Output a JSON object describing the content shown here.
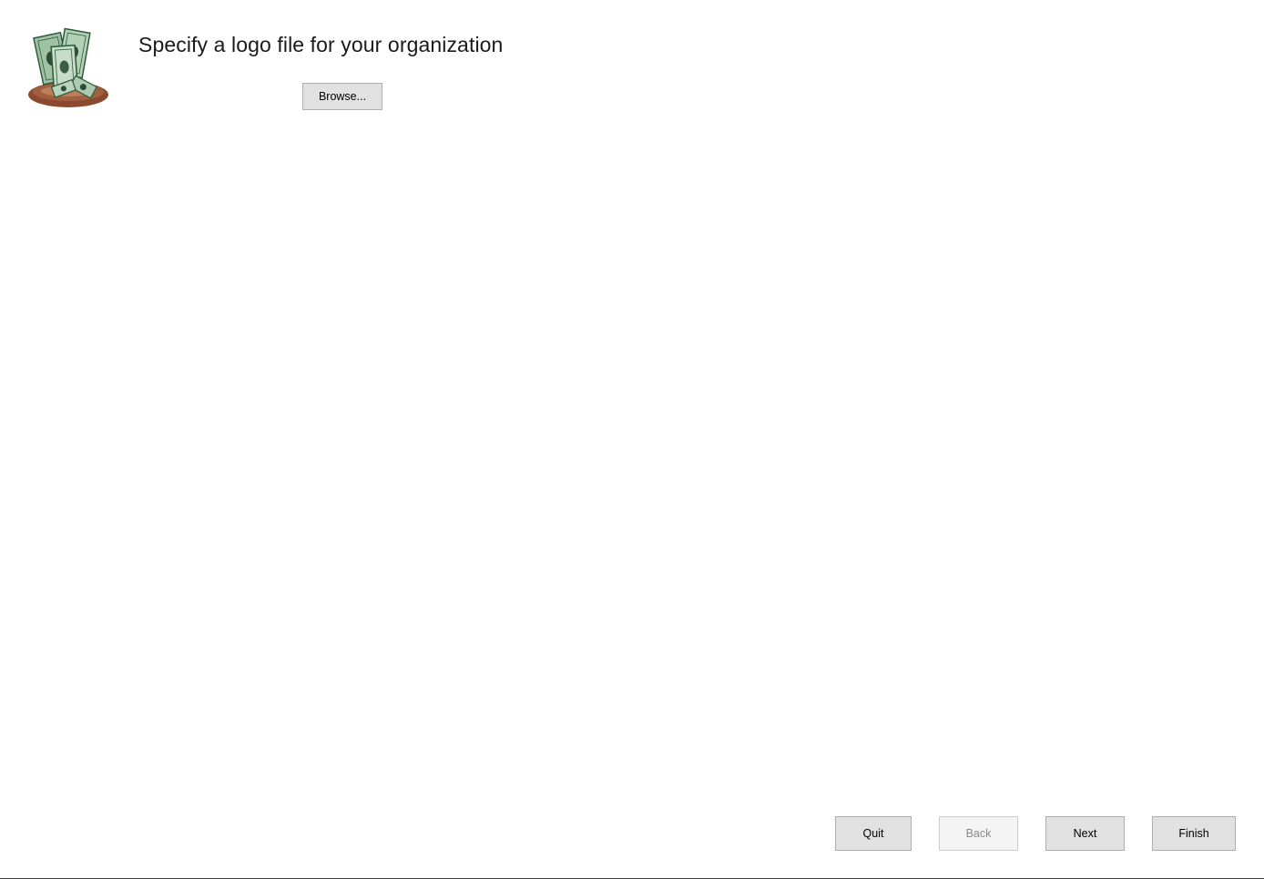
{
  "header": {
    "title": "Specify a logo file for your organization",
    "logo_icon": "money-bills-on-plate-icon"
  },
  "form": {
    "browse_label": "Browse..."
  },
  "footer": {
    "quit_label": "Quit",
    "back_label": "Back",
    "back_enabled": false,
    "next_label": "Next",
    "finish_label": "Finish"
  },
  "colors": {
    "bill_green": "#8fb596",
    "plate_brown": "#8b4a2f",
    "button_face": "#e1e1e1",
    "button_border": "#adadad"
  }
}
